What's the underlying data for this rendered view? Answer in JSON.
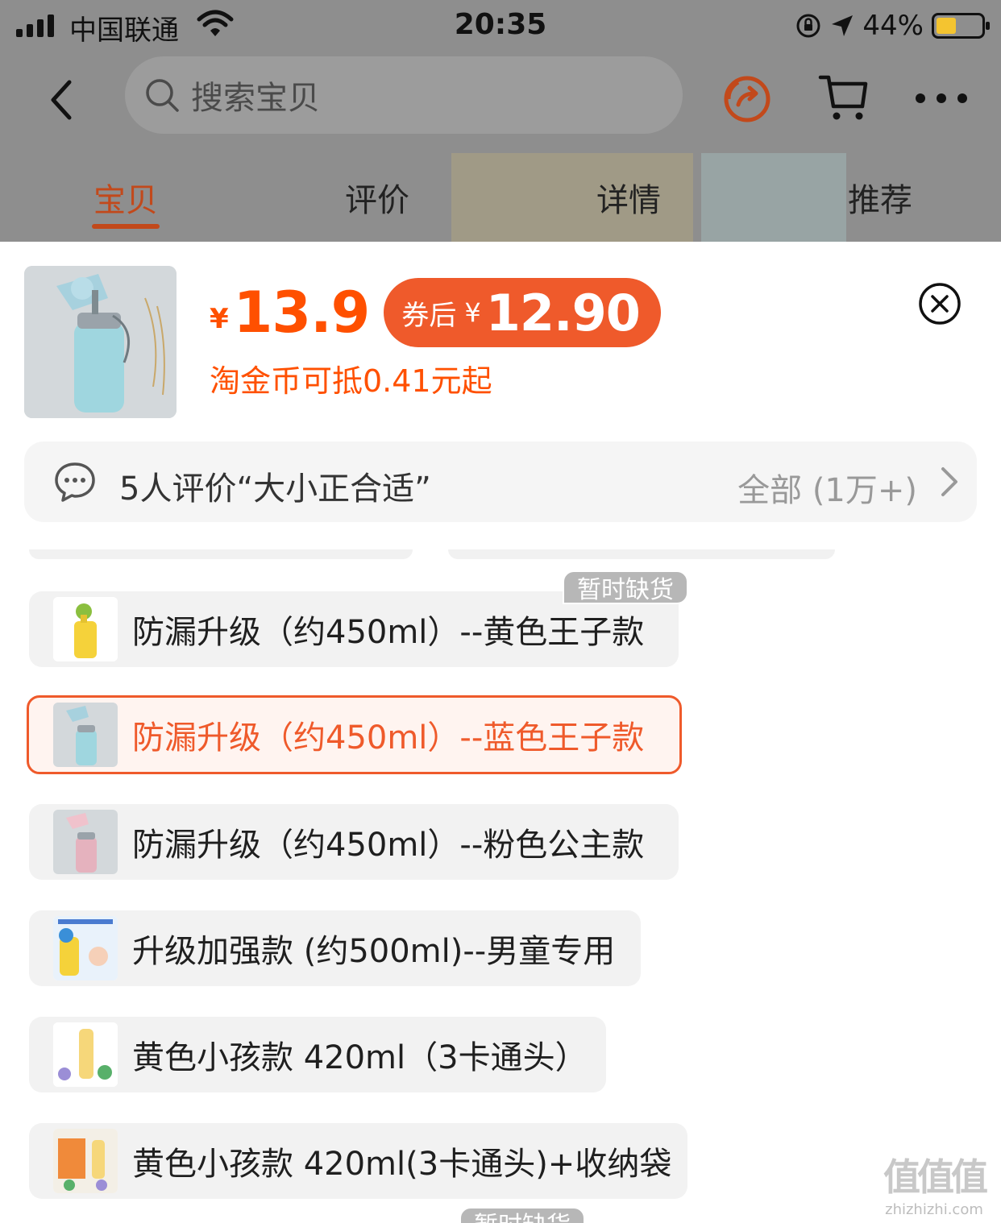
{
  "status_bar": {
    "carrier": "中国联通",
    "time": "20:35",
    "battery_percent": "44%"
  },
  "nav": {
    "search_placeholder": "搜索宝贝",
    "icons": [
      "back-icon",
      "search-icon",
      "share-icon",
      "cart-icon",
      "more-icon"
    ]
  },
  "tabs": [
    {
      "label": "宝贝",
      "active": true
    },
    {
      "label": "评价",
      "active": false
    },
    {
      "label": "详情",
      "active": false
    },
    {
      "label": "推荐",
      "active": false
    }
  ],
  "product": {
    "currency": "¥",
    "price": "13.9",
    "coupon_label": "券后",
    "coupon_currency": "¥",
    "coupon_price": "12.90",
    "coin_note": "淘金币可抵0.41元起"
  },
  "review": {
    "summary": "5人评价“大小正合适”",
    "all_label": "全部 (1万+)"
  },
  "skus": [
    {
      "label": "防漏升级（约450ml）--黄色王子款",
      "selected": false,
      "badge": "暂时缺货"
    },
    {
      "label": "防漏升级（约450ml）--蓝色王子款",
      "selected": true
    },
    {
      "label": "防漏升级（约450ml）--粉色公主款",
      "selected": false
    },
    {
      "label": "升级加强款 (约500ml)--男童专用",
      "selected": false
    },
    {
      "label": "黄色小孩款 420ml（3卡通头）",
      "selected": false
    },
    {
      "label": "黄色小孩款 420ml(3卡通头)+收纳袋",
      "selected": false
    },
    {
      "label": "",
      "selected": false,
      "badge": "暂时缺货"
    }
  ],
  "colors": {
    "accent": "#ff5000",
    "coupon_bg": "#ef5a2b",
    "active_tab": "#c2491b"
  },
  "watermark": {
    "glyphs": "值值值",
    "site": "zhizhizhi.com"
  }
}
